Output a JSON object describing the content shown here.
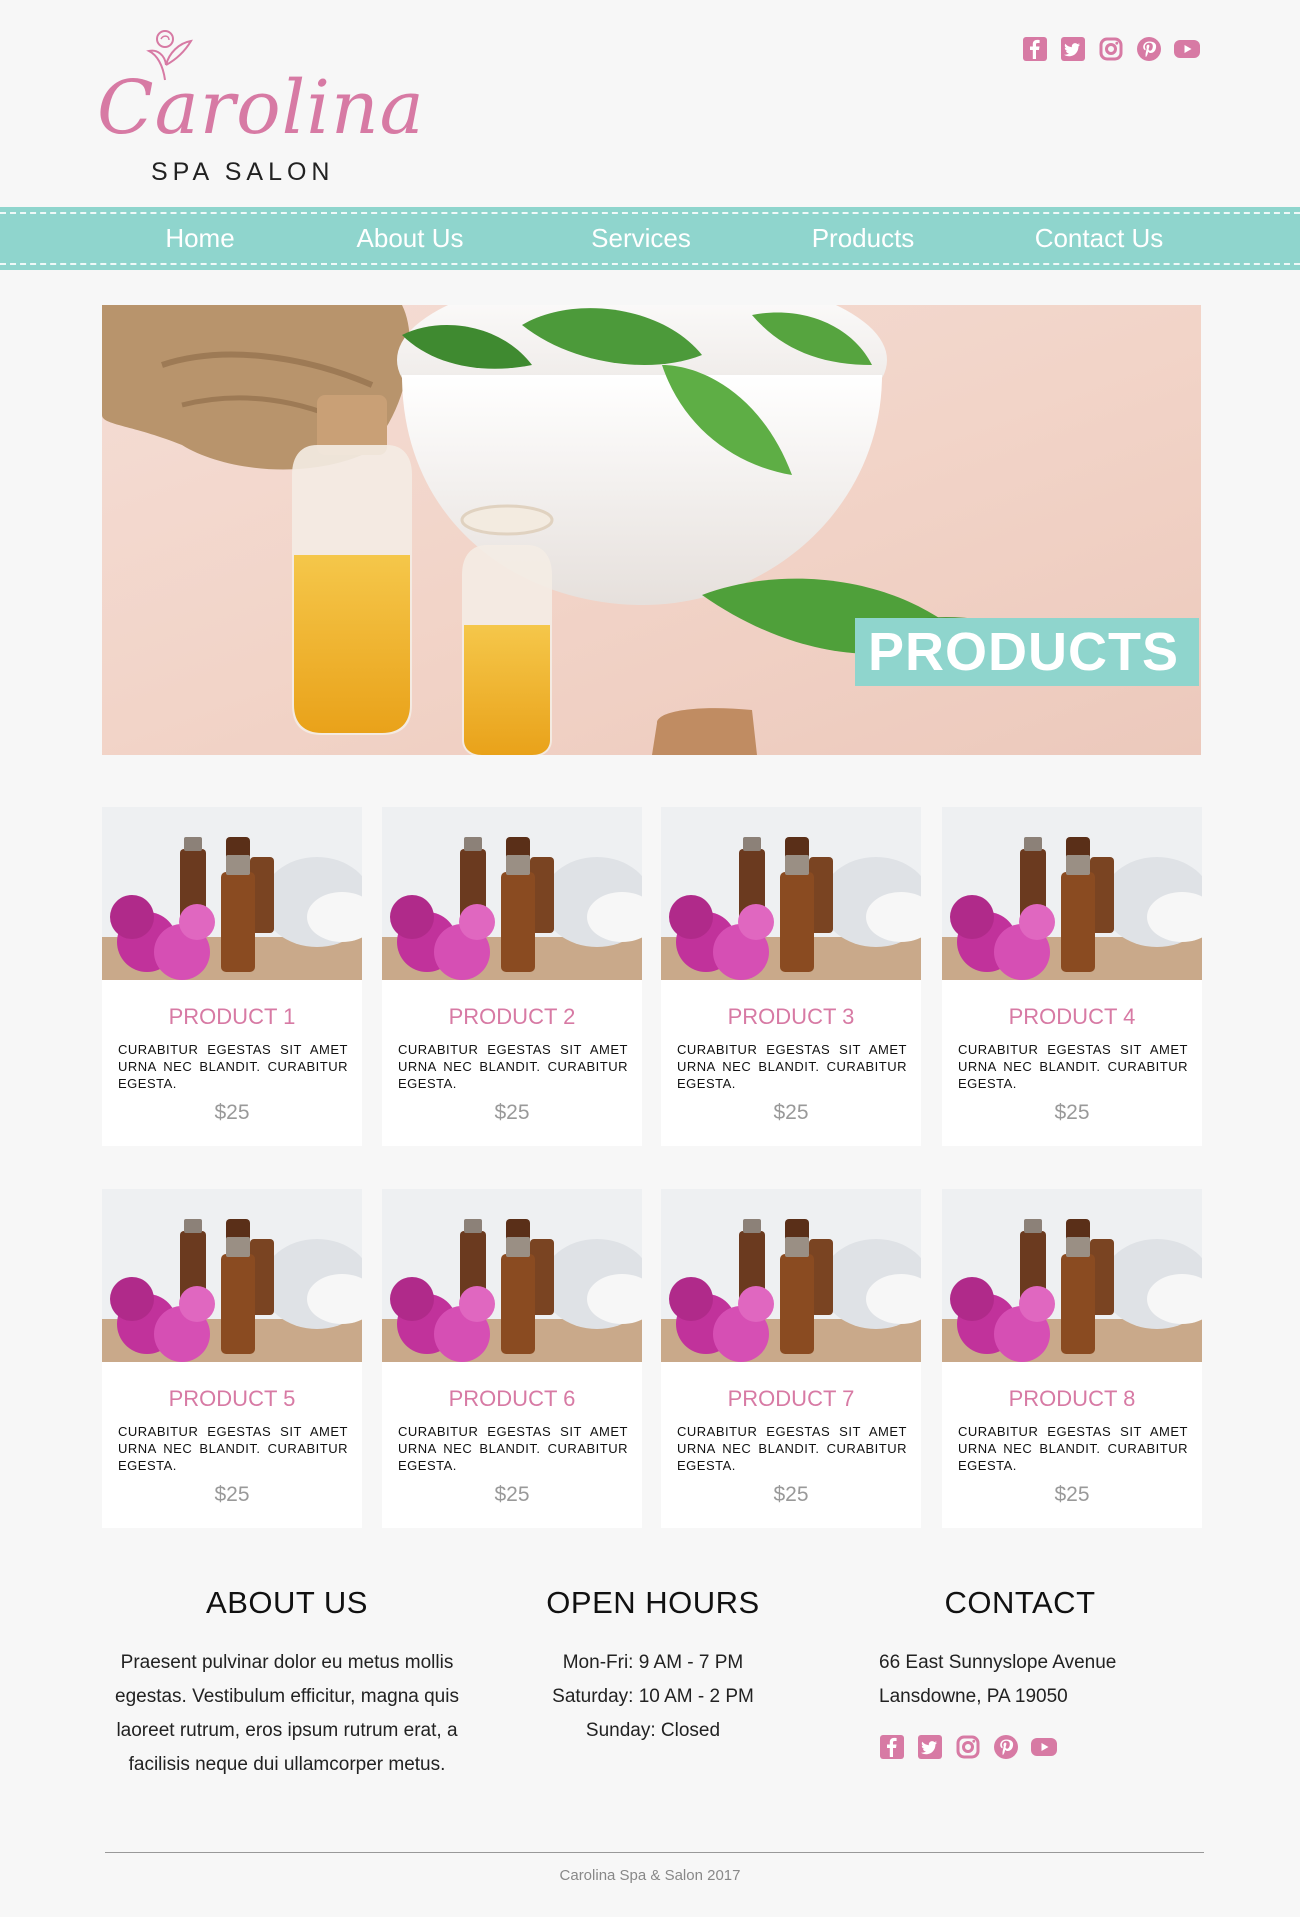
{
  "brand": {
    "name": "Carolina",
    "tagline": "SPA SALON",
    "accent": "#d77aa4",
    "teal": "#8fd5cd"
  },
  "social": [
    "facebook-icon",
    "twitter-icon",
    "instagram-icon",
    "pinterest-icon",
    "youtube-icon"
  ],
  "nav": {
    "items": [
      "Home",
      "About Us",
      "Services",
      "Products",
      "Contact Us"
    ]
  },
  "hero": {
    "label": "PRODUCTS"
  },
  "products": [
    {
      "name": "PRODUCT 1",
      "desc": "Curabitur egestas sit amet urna nec blandit. Curabitur egesta.",
      "price": "$25"
    },
    {
      "name": "PRODUCT 2",
      "desc": "Curabitur egestas sit amet urna nec blandit. Curabitur egesta.",
      "price": "$25"
    },
    {
      "name": "PRODUCT 3",
      "desc": "Curabitur egestas sit amet urna nec blandit. Curabitur egesta.",
      "price": "$25"
    },
    {
      "name": "PRODUCT 4",
      "desc": "Curabitur egestas sit amet urna nec blandit. Curabitur egesta.",
      "price": "$25"
    },
    {
      "name": "PRODUCT 5",
      "desc": "Curabitur egestas sit amet urna nec blandit. Curabitur egesta.",
      "price": "$25"
    },
    {
      "name": "PRODUCT 6",
      "desc": "Curabitur egestas sit amet urna nec blandit. Curabitur egesta.",
      "price": "$25"
    },
    {
      "name": "PRODUCT 7",
      "desc": "Curabitur egestas sit amet urna nec blandit. Curabitur egesta.",
      "price": "$25"
    },
    {
      "name": "PRODUCT 8",
      "desc": "Curabitur egestas sit amet urna nec blandit. Curabitur egesta.",
      "price": "$25"
    }
  ],
  "footer": {
    "about": {
      "title": "ABOUT US",
      "text": "Praesent pulvinar dolor eu metus mollis egestas. Vestibulum efficitur, magna quis laoreet rutrum, eros ipsum rutrum erat, a facilisis neque dui ullamcorper metus."
    },
    "hours": {
      "title": "OPEN HOURS",
      "lines": [
        "Mon-Fri: 9 AM - 7 PM",
        "Saturday: 10 AM - 2 PM",
        "Sunday: Closed"
      ]
    },
    "contact": {
      "title": "CONTACT",
      "lines": [
        "66 East Sunnyslope Avenue",
        "Lansdowne, PA 19050"
      ]
    },
    "copyright": "Carolina Spa & Salon 2017"
  }
}
